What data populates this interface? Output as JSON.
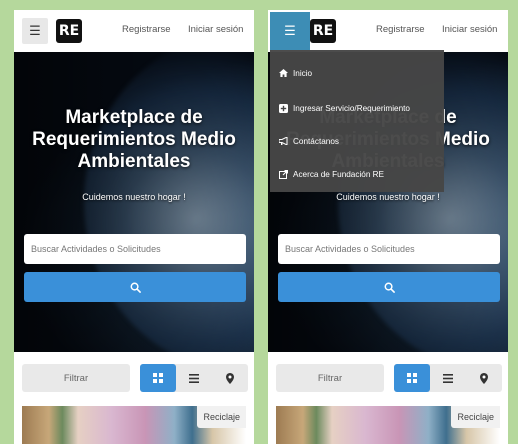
{
  "brand": {
    "logo_text": "RE"
  },
  "nav": {
    "register": "Registrarse",
    "login": "Iniciar sesión"
  },
  "hero": {
    "title": "Marketplace de Requerimientos Medio Ambientales",
    "subtitle": "Cuidemos nuestro hogar !",
    "search_placeholder": "Buscar Actividades o Solicitudes"
  },
  "filters": {
    "filter_label": "Filtrar",
    "views": [
      "grid-view",
      "list-view",
      "map-view"
    ],
    "active_view": "grid-view"
  },
  "card": {
    "badge": "Reciclaje"
  },
  "menu": {
    "items": [
      {
        "label": "Inicio",
        "icon": "home-icon"
      },
      {
        "label": "Ingresar Servicio/Requerimiento",
        "icon": "plus-square-icon"
      },
      {
        "label": "Contáctanos",
        "icon": "megaphone-icon"
      },
      {
        "label": "Acerca de Fundación RE",
        "icon": "external-link-icon"
      }
    ]
  },
  "colors": {
    "background": "#b5d89c",
    "accent": "#3a90d9",
    "menu_active": "#3d8db5",
    "dropdown": "#464646"
  }
}
